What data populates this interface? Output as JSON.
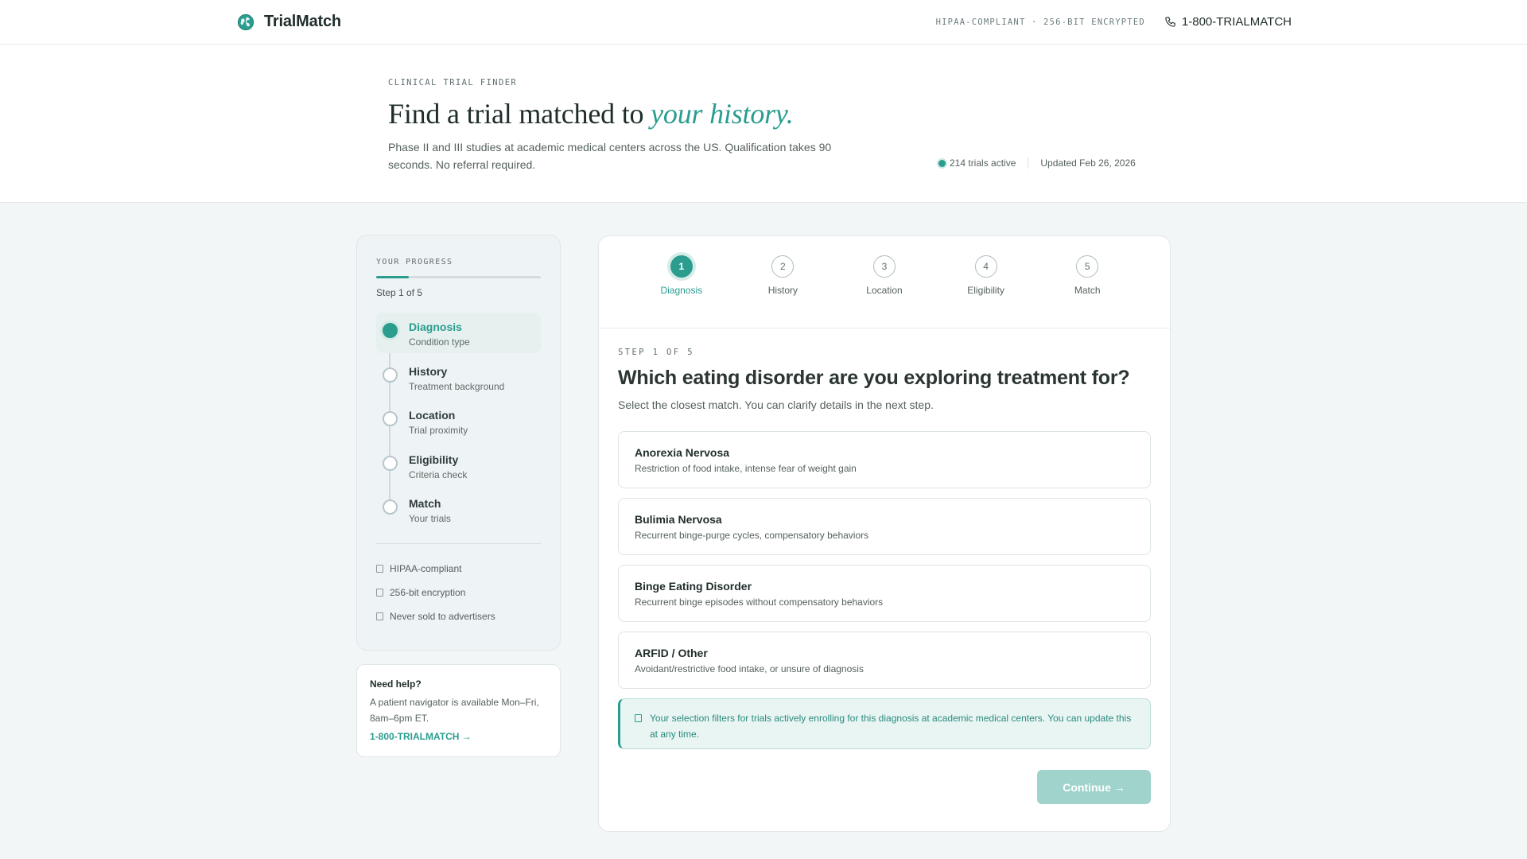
{
  "header": {
    "brand": "TrialMatch",
    "compliance": "HIPAA-COMPLIANT · 256-BIT ENCRYPTED",
    "phone": "1-800-TRIALMATCH",
    "icons": {
      "logo": "globe-logo-icon",
      "phone": "phone-icon"
    }
  },
  "hero": {
    "eyebrow": "CLINICAL TRIAL FINDER",
    "title_plain": "Find a trial matched to ",
    "title_emphasis": "your history.",
    "subtitle": "Phase II and III studies at academic medical centers across the US. Qualification takes 90 seconds. No referral required.",
    "trials_active": "214 trials active",
    "updated": "Updated Feb 26, 2026"
  },
  "sidebar": {
    "eyebrow": "YOUR PROGRESS",
    "progress_fraction": 0.2,
    "progress_text": "Step 1 of 5",
    "steps": [
      {
        "title": "Diagnosis",
        "sub": "Condition type",
        "active": true
      },
      {
        "title": "History",
        "sub": "Treatment background",
        "active": false
      },
      {
        "title": "Location",
        "sub": "Trial proximity",
        "active": false
      },
      {
        "title": "Eligibility",
        "sub": "Criteria check",
        "active": false
      },
      {
        "title": "Match",
        "sub": "Your trials",
        "active": false
      }
    ],
    "trust": [
      "HIPAA-compliant",
      "256-bit encryption",
      "Never sold to advertisers"
    ]
  },
  "help": {
    "title": "Need help?",
    "text": "A patient navigator is available Mon–Fri, 8am–6pm ET.",
    "link": "1-800-TRIALMATCH →"
  },
  "stepper": [
    {
      "num": "1",
      "label": "Diagnosis",
      "active": true
    },
    {
      "num": "2",
      "label": "History",
      "active": false
    },
    {
      "num": "3",
      "label": "Location",
      "active": false
    },
    {
      "num": "4",
      "label": "Eligibility",
      "active": false
    },
    {
      "num": "5",
      "label": "Match",
      "active": false
    }
  ],
  "question": {
    "eyebrow": "STEP 1 OF 5",
    "title": "Which eating disorder are you exploring treatment for?",
    "subtitle": "Select the closest match. You can clarify details in the next step.",
    "options": [
      {
        "title": "Anorexia Nervosa",
        "desc": "Restriction of food intake, intense fear of weight gain"
      },
      {
        "title": "Bulimia Nervosa",
        "desc": "Recurrent binge-purge cycles, compensatory behaviors"
      },
      {
        "title": "Binge Eating Disorder",
        "desc": "Recurrent binge episodes without compensatory behaviors"
      },
      {
        "title": "ARFID / Other",
        "desc": "Avoidant/restrictive food intake, or unsure of diagnosis"
      }
    ],
    "notice": "Your selection filters for trials actively enrolling for this diagnosis at academic medical centers. You can update this at any time.",
    "continue_label": "Continue →"
  },
  "colors": {
    "accent": "#2a9d8f",
    "accent_disabled": "#9fd3cb",
    "notice_bg": "#e9f5f3"
  }
}
